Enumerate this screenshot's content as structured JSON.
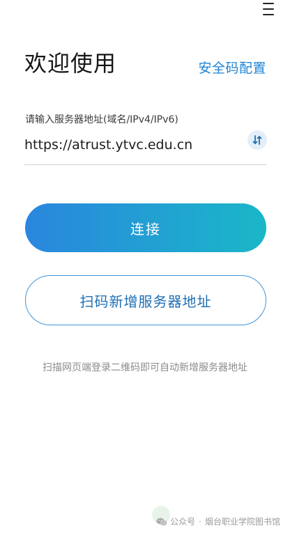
{
  "header": {
    "menu_icon": "hamburger-menu-icon",
    "title": "欢迎使用",
    "security_link": "安全码配置"
  },
  "server": {
    "label": "请输入服务器地址(域名/IPv4/IPv6)",
    "value": "https://atrust.ytvc.edu.cn",
    "switch_icon": "switch-arrows-icon"
  },
  "actions": {
    "connect_label": "连接",
    "scan_label": "扫码新增服务器地址",
    "hint": "扫描网页端登录二维码即可自动新增服务器地址"
  },
  "watermark": {
    "icon": "wechat-icon",
    "prefix": "公众号",
    "separator": "·",
    "account": "烟台职业学院图书馆"
  },
  "colors": {
    "accent": "#1e83d3",
    "gradient_start": "#2a86de",
    "gradient_end": "#1ab7c8",
    "outline": "#3f94d6"
  }
}
